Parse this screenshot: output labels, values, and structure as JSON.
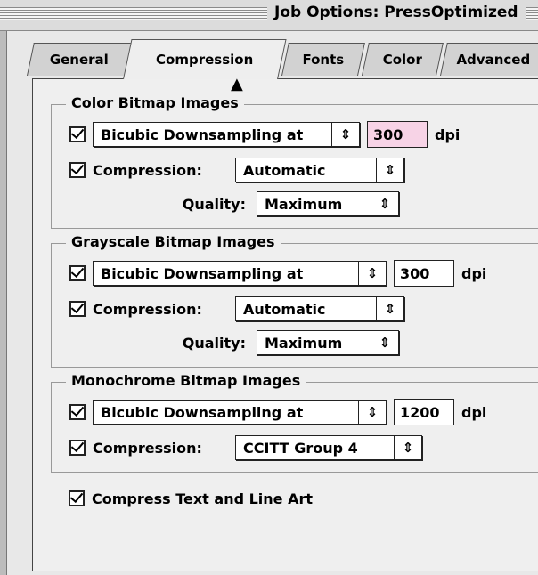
{
  "window": {
    "title": "Job Options: PressOptimized"
  },
  "tabs": [
    {
      "label": "General"
    },
    {
      "label": "Compression"
    },
    {
      "label": "Fonts"
    },
    {
      "label": "Color"
    },
    {
      "label": "Advanced"
    }
  ],
  "groups": {
    "color": {
      "title": "Color Bitmap Images",
      "sampling_label": "Bicubic Downsampling at",
      "resolution": "300",
      "unit": "dpi",
      "compression_label": "Compression:",
      "compression_value": "Automatic",
      "quality_label": "Quality:",
      "quality_value": "Maximum"
    },
    "grayscale": {
      "title": "Grayscale Bitmap Images",
      "sampling_label": "Bicubic Downsampling at",
      "resolution": "300",
      "unit": "dpi",
      "compression_label": "Compression:",
      "compression_value": "Automatic",
      "quality_label": "Quality:",
      "quality_value": "Maximum"
    },
    "mono": {
      "title": "Monochrome Bitmap Images",
      "sampling_label": "Bicubic Downsampling at",
      "resolution": "1200",
      "unit": "dpi",
      "compression_label": "Compression:",
      "compression_value": "CCITT Group 4"
    }
  },
  "compress_text_label": "Compress Text and Line Art",
  "icons": {
    "popup_arrows": "⇕",
    "check": "check-icon",
    "cursor": "arrow-cursor-icon"
  },
  "colors": {
    "resolution_highlight": "#f7d3e6",
    "panel": "#efefef"
  }
}
